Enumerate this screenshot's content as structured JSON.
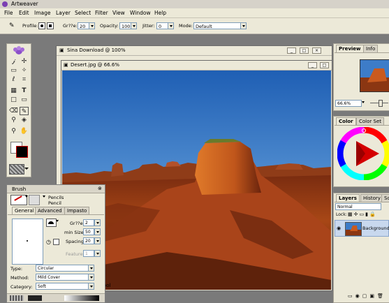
{
  "app": {
    "title": "Artweaver"
  },
  "menu": [
    "File",
    "Edit",
    "Image",
    "Layer",
    "Select",
    "Filter",
    "View",
    "Window",
    "Help"
  ],
  "options": {
    "profile_label": "Profile:",
    "size_label": "Gr??e:",
    "size_value": "20",
    "opacity_label": "Opacity:",
    "opacity_value": "100",
    "jitter_label": "Jitter:",
    "jitter_value": "0",
    "mode_label": "Mode:",
    "mode_value": "Default"
  },
  "windows": {
    "back_title": "Sina Download @ 100%",
    "front_title": "Desert.jpg @ 66.6%",
    "status_text": "ool"
  },
  "preview": {
    "tabs": [
      "Preview",
      "Info"
    ],
    "zoom": "66.6%"
  },
  "color": {
    "tabs": [
      "Color",
      "Color Set"
    ]
  },
  "layers": {
    "tabs": [
      "Layers",
      "History",
      "Sc"
    ],
    "mode": "Normal",
    "lock_label": "Lock:",
    "layer_name": "Background"
  },
  "brush": {
    "title": "Brush",
    "category": "Pencils",
    "variant": "Pencil",
    "tabs": [
      "General",
      "Advanced",
      "Impasto"
    ],
    "size_label": "Gr??e:",
    "size_value": "2",
    "minsize_label": "min Size:",
    "minsize_value": "50",
    "spacing_label": "Spacing:",
    "spacing_value": "20",
    "feature_label": "Feature:",
    "feature_value": "1",
    "type_label": "Type:",
    "type_value": "Circular",
    "method_label": "Method:",
    "method_value": "Mild Cover",
    "cat_label": "Category:",
    "cat_value": "Soft"
  }
}
